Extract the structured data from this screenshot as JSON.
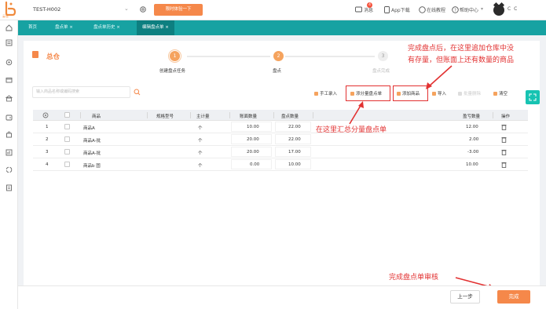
{
  "brand": {
    "logo_text": "b",
    "logo_caption": "云仓"
  },
  "top": {
    "store_name": "TEST-H002",
    "upgrade_label": "限时体验一下",
    "message_label": "消息",
    "message_badge": "4",
    "app_label": "App下载",
    "courses_label": "在线教程",
    "help_label": "帮助中心",
    "user_name": "C C"
  },
  "tabs": [
    {
      "label": "首页",
      "closable": false
    },
    {
      "label": "盘点单",
      "closable": true
    },
    {
      "label": "盘点单历史",
      "closable": true
    },
    {
      "label": "编辑盘点单",
      "closable": true,
      "active": true
    }
  ],
  "close_glyph": "×",
  "card": {
    "title": "总仓"
  },
  "steps": [
    {
      "number": "1",
      "label": "创建盘点任务",
      "state": "done"
    },
    {
      "number": "2",
      "label": "盘点",
      "state": "current"
    },
    {
      "number": "3",
      "label": "盘点完成",
      "state": "pending"
    }
  ],
  "search": {
    "placeholder": "输入商品名称或编码搜索"
  },
  "toolbar": {
    "manual_entry": "手工录入",
    "add_sub_sheet": "添分量盘点单",
    "add_product": "添加商品",
    "import": "导入",
    "batch_delete": "批量删除",
    "clear": "清空"
  },
  "table": {
    "headers": {
      "product": "商品",
      "spec": "规格型号",
      "unit": "主计量",
      "book_qty": "账面数量",
      "count_qty": "盘点数量",
      "diff_qty": "盈亏数量",
      "action": "操作"
    },
    "rows": [
      {
        "no": "1",
        "product": "商品A",
        "unit": "个",
        "book_qty": "10.00",
        "count_qty": "22.00",
        "diff_qty": "12.00"
      },
      {
        "no": "2",
        "product": "商品A-批",
        "unit": "个",
        "book_qty": "20.00",
        "count_qty": "22.00",
        "diff_qty": "2.00"
      },
      {
        "no": "3",
        "product": "商品A-批",
        "unit": "个",
        "book_qty": "20.00",
        "count_qty": "17.00",
        "diff_qty": "-3.00"
      },
      {
        "no": "4",
        "product": "商品b 固",
        "unit": "个",
        "book_qty": "0.00",
        "count_qty": "10.00",
        "diff_qty": "10.00"
      }
    ]
  },
  "annotations": {
    "top_right_line1": "完成盘点后，在这里追加仓库中没",
    "top_right_line2": "有存量，但账面上还有数量的商品",
    "middle": "在这里汇总分量盘点单",
    "bottom": "完成盘点单审核"
  },
  "footer": {
    "prev_label": "上一步",
    "submit_label": "完成"
  },
  "colors": {
    "teal": "#17a2a2",
    "orange": "#f5884a",
    "annotation_red": "#e23131"
  },
  "icons": {
    "sidebar": [
      "home-icon",
      "list-icon",
      "gear-icon",
      "box-icon",
      "bank-icon",
      "wallet-icon",
      "bag-icon",
      "report-icon",
      "loop-icon",
      "doc-icon"
    ]
  }
}
